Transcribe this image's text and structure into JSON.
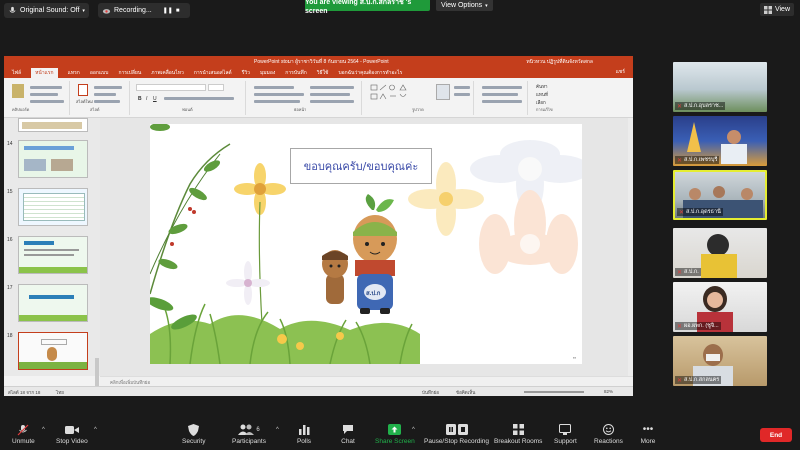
{
  "top": {
    "original_sound": "Original Sound: Off",
    "recording": "Recording...",
    "viewing": "You are viewing ส.ป.ก.สกลราชี 's screen",
    "view_options": "View Options",
    "view": "View"
  },
  "ppt": {
    "title": "PowerPoint stoมา ผู้ราชาวิวันที่ 8 กันยายน 2564  -  PowerPoint",
    "user": "ทนิวหวน ปฏิรูปที่ดินจังหวัดสกล",
    "tabs": [
      "ไฟล์",
      "หน้าแรก",
      "แทรก",
      "ออกแบบ",
      "การเปลี่ยน",
      "ภาพเคลื่อนไหว",
      "การนำเสนอสไลด์",
      "รีวิว",
      "มุมมอง",
      "การบันทึก",
      "วิธีใช้",
      "บอกฉันว่าคุณต้องการทำอะไร"
    ],
    "active_tab": "หน้าแรก",
    "share": "แชร์",
    "ribbon": {
      "clipboard": "คลิปบอร์ด",
      "slides": "สไลด์",
      "font": "ฟอนต์",
      "paragraph": "ย่อหน้า",
      "drawing": "รูปวาด",
      "editing": "การแก้ไข",
      "new_slide": "สไลด์ใหม่",
      "find": "ค้นหา",
      "replace": "แทนที่",
      "select": "เลือก"
    },
    "thumbs": [
      "14",
      "15",
      "16",
      "17",
      "18"
    ],
    "slide_text": "ขอบคุณครับ/ขอบคุณค่ะ",
    "mascot_label": "ส.ป.ก",
    "notes": "คลิกเพื่อเพิ่มบันทึกย่อ",
    "status_left": "สไลด์ 18 จาก 18",
    "status_lang": "ไทย",
    "status_notes": "บันทึกย่อ",
    "status_comments": "ข้อคิดเห็น",
    "zoom": "82%"
  },
  "participants": [
    {
      "name": "ส.ป.ก.อุบลราช...",
      "muted": true,
      "active": false
    },
    {
      "name": "ส.ป.ก.เพชรบุรี",
      "muted": true,
      "active": false
    },
    {
      "name": "ส.ป.ก.อุดรธานี",
      "muted": true,
      "active": true
    },
    {
      "name": "ส.ป.ก.",
      "muted": true,
      "active": false
    },
    {
      "name": "ผอ.ผพก. (ชูจิ...",
      "muted": true,
      "active": false
    },
    {
      "name": "ส.ป.ก.สกลนคร",
      "muted": true,
      "active": false
    }
  ],
  "toolbar": {
    "unmute": "Unmute",
    "stop_video": "Stop Video",
    "security": "Security",
    "participants": "Participants",
    "participants_count": "6",
    "polls": "Polls",
    "chat": "Chat",
    "share_screen": "Share Screen",
    "pause_recording": "Pause/Stop Recording",
    "breakout": "Breakout Rooms",
    "support": "Support",
    "reactions": "Reactions",
    "more": "More",
    "end": "End"
  },
  "colors": {
    "ppt_accent": "#c43e1c",
    "zoom_green": "#1f9a3a",
    "end_red": "#e02828",
    "active_speaker": "#e5ed32"
  }
}
